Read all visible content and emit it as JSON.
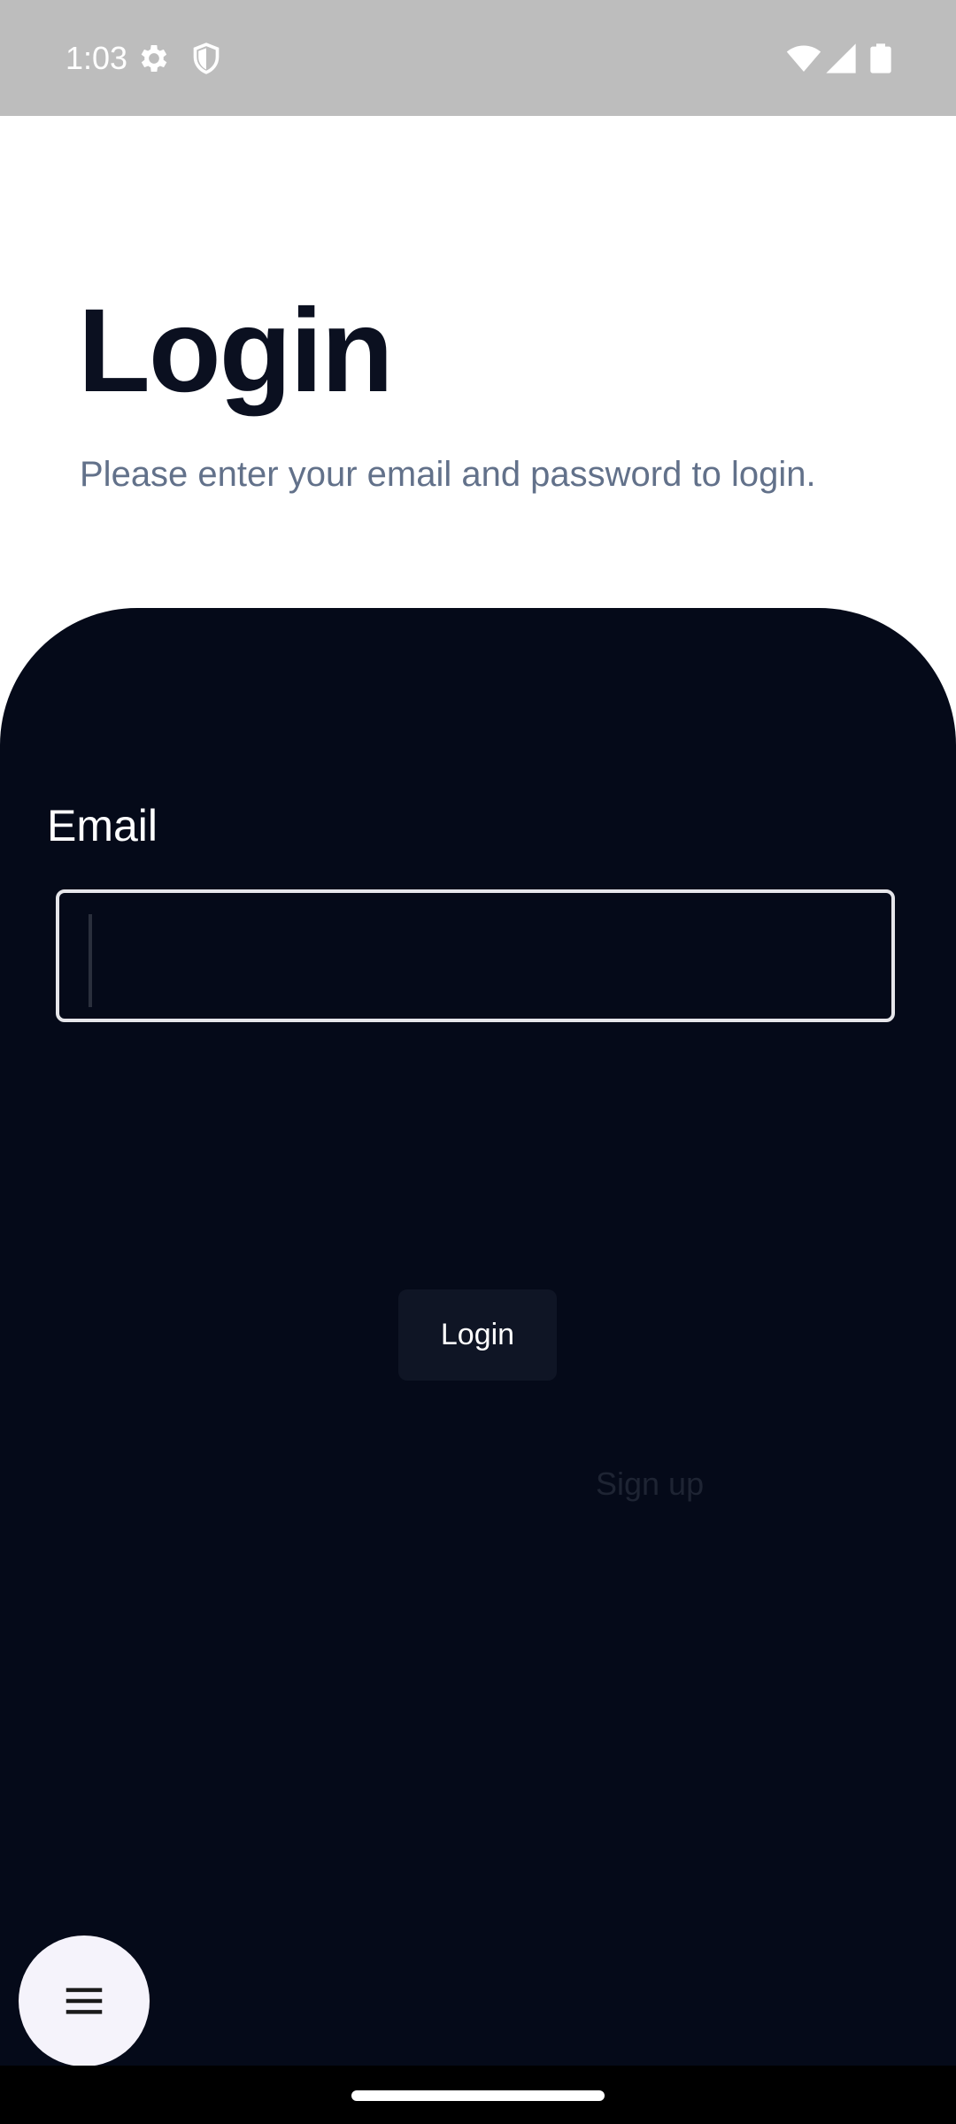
{
  "status_bar": {
    "time": "1:03",
    "icons": [
      "gear-icon",
      "shield-icon",
      "wifi-icon",
      "signal-icon",
      "battery-icon"
    ]
  },
  "header": {
    "title": "Login",
    "subtitle": "Please enter your email and password to login."
  },
  "form": {
    "email_label": "Email",
    "email_value": "",
    "login_button_label": "Login",
    "signup_link_label": "Sign up"
  },
  "fab": {
    "icon": "menu-icon"
  },
  "colors": {
    "status_bar": "#bdbdbd",
    "card_background": "#050a19",
    "title": "#0b1020",
    "subtitle": "#62718a",
    "button_background": "#0f1525",
    "fab_background": "#f5f3fb"
  }
}
